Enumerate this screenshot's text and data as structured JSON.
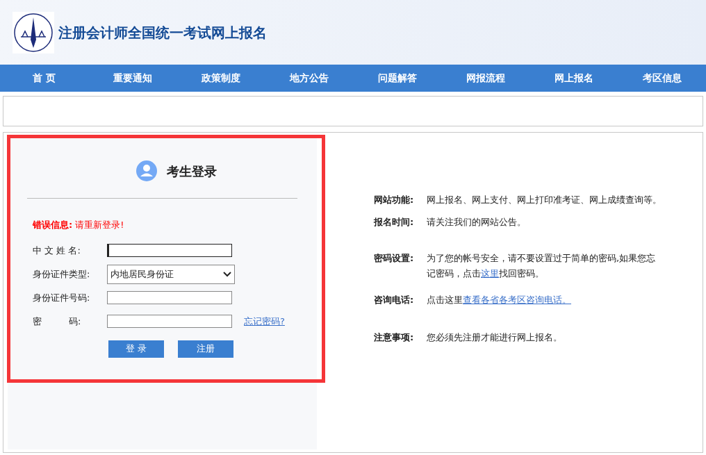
{
  "header": {
    "title": "注册会计师全国统一考试网上报名"
  },
  "nav": [
    {
      "label": "首 页"
    },
    {
      "label": "重要通知"
    },
    {
      "label": "政策制度"
    },
    {
      "label": "地方公告"
    },
    {
      "label": "问题解答"
    },
    {
      "label": "网报流程"
    },
    {
      "label": "网上报名"
    },
    {
      "label": "考区信息"
    }
  ],
  "login": {
    "title": "考生登录",
    "error_label": "错误信息:",
    "error_message": "请重新登录!",
    "fields": [
      {
        "kind": "text",
        "label": "中 文 姓 名:",
        "focused": true
      },
      {
        "kind": "select",
        "label": "身份证件类型:",
        "value": "内地居民身份证"
      },
      {
        "kind": "text",
        "label": "身份证件号码:",
        "focused": false
      },
      {
        "kind": "password",
        "label": "密　　　码:",
        "focused": false,
        "link": "忘记密码?"
      }
    ],
    "buttons": [
      "登 录",
      "注册"
    ]
  },
  "info": [
    {
      "label": "网站功能:",
      "parts": [
        {
          "text": "网上报名、网上支付、网上打印准考证、网上成绩查询等。",
          "link": false
        }
      ]
    },
    {
      "label": "报名时间:",
      "parts": [
        {
          "text": "请关注我们的网站公告。",
          "link": false
        }
      ]
    },
    {
      "label": "密码设置:",
      "parts": [
        {
          "text": "为了您的帐号安全，请不要设置过于简单的密码,如果您忘记密码，点击",
          "link": false
        },
        {
          "text": "这里",
          "link": true
        },
        {
          "text": "找回密码。",
          "link": false
        }
      ]
    },
    {
      "label": "咨询电话:",
      "parts": [
        {
          "text": "点击这里",
          "link": false
        },
        {
          "text": "查看各省各考区咨询电话。",
          "link": true
        }
      ]
    },
    {
      "label": "注意事项:",
      "parts": [
        {
          "text": "您必须先注册才能进行网上报名。",
          "link": false
        }
      ]
    }
  ]
}
